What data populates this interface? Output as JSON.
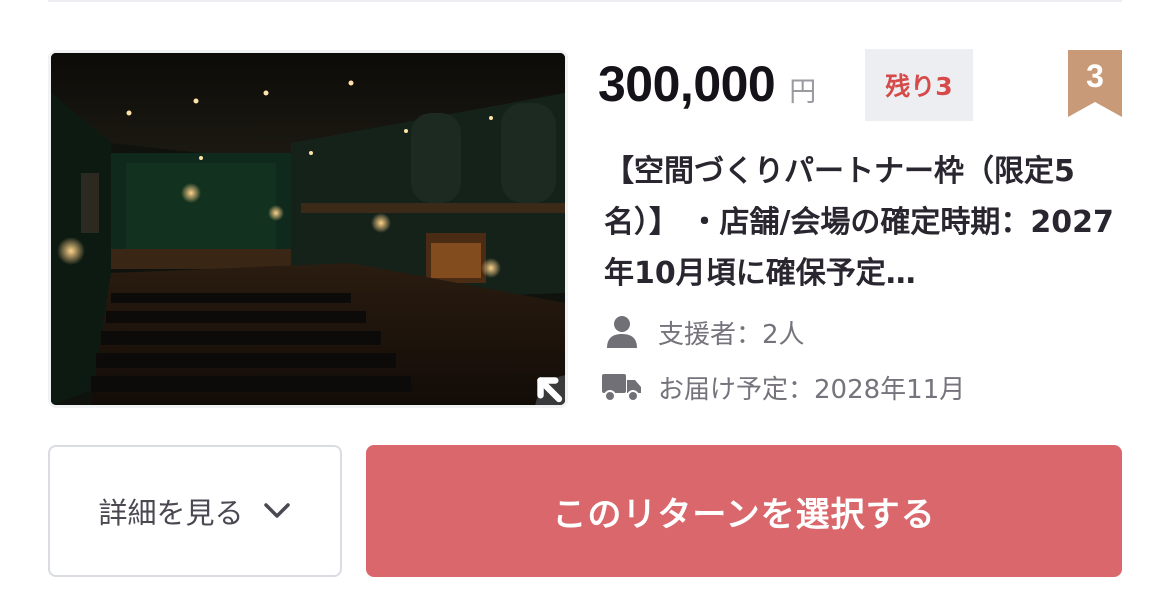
{
  "reward": {
    "price": "300,000",
    "currency": "円",
    "stock_badge": "残り3",
    "rank": "3",
    "title": "【空間づくりパートナー枠（限定5名）】 ・店舗/会場の確定時期：2027年10月頃に確保予定…",
    "supporters": "支援者：2人",
    "delivery": "お届け予定：2028年11月",
    "image_icon": "expand-icon"
  },
  "actions": {
    "details_label": "詳細を見る",
    "select_label": "このリターンを選択する"
  },
  "colors": {
    "accent": "#d9676b",
    "stock_text": "#d74a4a",
    "rank_ribbon": "#c99a78"
  }
}
